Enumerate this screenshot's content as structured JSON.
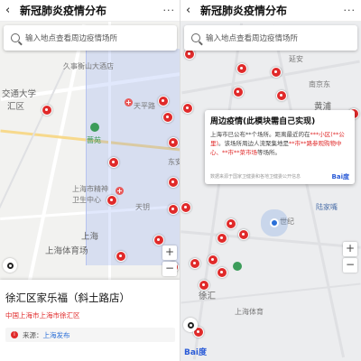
{
  "left": {
    "title": "新冠肺炎疫情分布",
    "more": "···",
    "search_placeholder": "输入地点查看周边疫情场所",
    "labels": {
      "jiuShi": "久事衡山大酒店",
      "jiaoTong": "交通大学",
      "huiCheng": "汇区",
      "tianPing": "天平路",
      "qinYuan": "蔷苑",
      "shangHaiShi": "上海市精神",
      "weiSheng": "卫生中心",
      "tiYuGuan": "上海体育场",
      "shanghai": "上海",
      "tianYao": "天钥",
      "dongAn": "东安"
    },
    "card": {
      "name": "徐汇区家乐福（斜土路店）",
      "address": "中国上海市上海市徐汇区",
      "source_label": "来源：",
      "source_link": "上海发布"
    }
  },
  "right": {
    "title": "新冠肺炎疫情分布",
    "more": "···",
    "search_placeholder": "输入地点查看周边疫情场所",
    "labels": {
      "yanAn": "延安",
      "nanJing": "南京东",
      "huangPu": "黄浦",
      "luJiaZui": "陆家嘴",
      "shiJi": "世纪",
      "xuHui": "徐汇",
      "tiYu": "上海体育"
    },
    "popup": {
      "title": "周边疫情(此模块需自己实现)",
      "body_prefix": "上海市已公布**个场所。距离最近的在",
      "body_place1": "***小区(**公里)",
      "body_mid": "。该场所周边人流聚集地是",
      "body_place2": "**市**路参观购物中心、**市**菜市场",
      "body_suffix": "等场所。",
      "footer": "数据来源于国家卫健委和各地卫健委公开信息",
      "logo": "Bai度"
    },
    "baidu_logo": "Bai度"
  },
  "colors": {
    "pin": "#e02a2a",
    "accent_blue": "#2a6fd8"
  }
}
